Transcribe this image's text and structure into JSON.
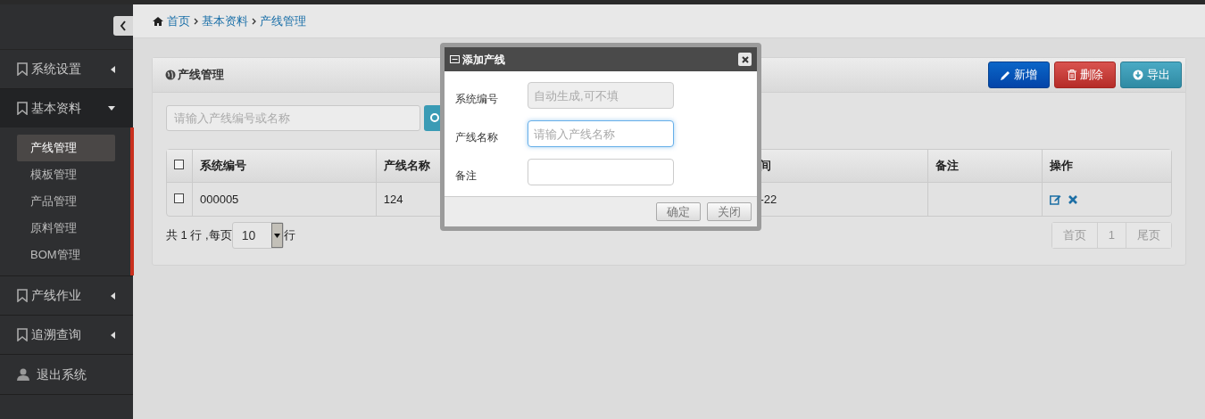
{
  "breadcrumb": [
    {
      "label": "首页"
    },
    {
      "label": "基本资料"
    },
    {
      "label": "产线管理"
    }
  ],
  "sidebar": {
    "items": [
      {
        "kind": "menu",
        "label": "系统设置",
        "expanded": false
      },
      {
        "kind": "menu",
        "label": "基本资料",
        "expanded": true,
        "children": [
          {
            "label": "产线管理",
            "selected": true
          },
          {
            "label": "模板管理",
            "selected": false
          },
          {
            "label": "产品管理",
            "selected": false
          },
          {
            "label": "原料管理",
            "selected": false
          },
          {
            "label": "BOM管理",
            "selected": false
          }
        ]
      },
      {
        "kind": "menu",
        "label": "产线作业",
        "expanded": false
      },
      {
        "kind": "menu",
        "label": "追溯查询",
        "expanded": false
      },
      {
        "kind": "logout",
        "label": "退出系统"
      }
    ]
  },
  "panel": {
    "title": "产线管理",
    "buttons": [
      {
        "kind": "add",
        "label": "新增"
      },
      {
        "kind": "delete",
        "label": "删除"
      },
      {
        "kind": "export",
        "label": "导出"
      }
    ],
    "search": {
      "placeholder": "请输入产线编号或名称"
    },
    "table": {
      "select_all_checked": false,
      "columns": [
        "系统编号",
        "产线名称",
        "间",
        "备注",
        "操作"
      ],
      "rows": [
        {
          "checked": false,
          "cells": [
            "000005",
            "124",
            "-22"
          ]
        }
      ]
    },
    "footer": {
      "total": "共 1 行 ,每页",
      "page_size": "10",
      "unit": "行",
      "pagination": [
        {
          "label": "首页",
          "disabled": true
        },
        {
          "label": "1",
          "disabled": true
        },
        {
          "label": "尾页",
          "disabled": true
        }
      ]
    }
  },
  "dialog": {
    "title": "添加产线",
    "fields": [
      {
        "label": "系统编号",
        "placeholder": "自动生成,可不填",
        "disabled": true,
        "focused": false
      },
      {
        "label": "产线名称",
        "placeholder": "请输入产线名称",
        "disabled": false,
        "focused": true
      },
      {
        "label": "备注",
        "disabled": false,
        "focused": false
      }
    ],
    "buttons": [
      "确定",
      "关闭"
    ]
  }
}
